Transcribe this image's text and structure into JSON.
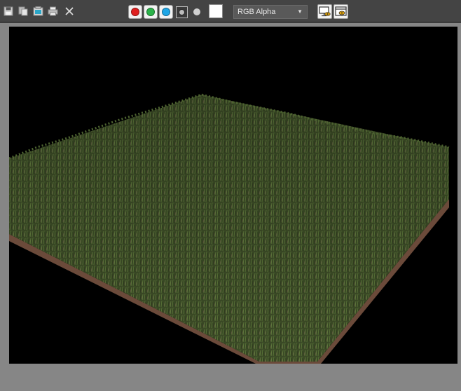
{
  "toolbar": {
    "icons": {
      "save": "save-icon",
      "clone": "clone-icon",
      "copy": "copy-image-icon",
      "print": "print-icon",
      "clear": "clear-icon"
    },
    "channels": {
      "red": "#e02020",
      "green": "#2bb34a",
      "blue": "#1ea6e6",
      "alpha": "alpha-icon",
      "mono": "mono-dot-icon"
    },
    "swatch_color": "#ffffff",
    "display_mode": {
      "selected": "RGB Alpha"
    },
    "right_icons": {
      "display_correction": "display-correction-icon",
      "toggle_ui": "toggle-ui-icon"
    }
  },
  "render": {
    "content": "grass-render",
    "background": "#000000"
  }
}
